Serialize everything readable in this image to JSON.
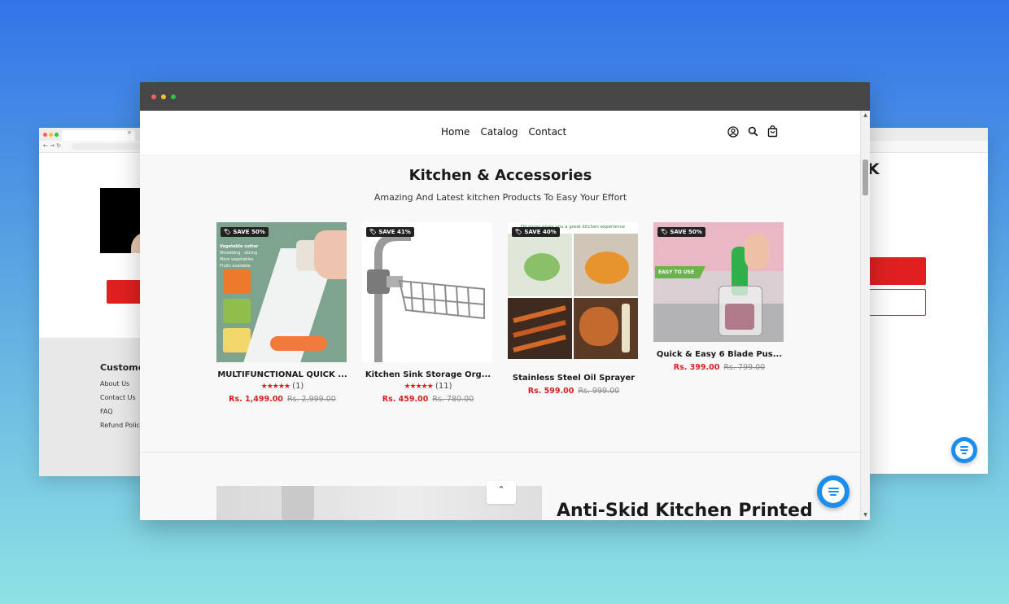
{
  "colors": {
    "accent": "#d62020",
    "chat": "#1a8ef0",
    "titlebar": "#464646"
  },
  "nav": {
    "items": [
      "Home",
      "Catalog",
      "Contact"
    ]
  },
  "header_icons": [
    "account-icon",
    "search-icon",
    "cart-icon"
  ],
  "section": {
    "title": "Kitchen & Accessories",
    "subtitle": "Amazing And Latest kitchen Products To Easy Your Effort"
  },
  "products": [
    {
      "badge": "SAVE 50%",
      "name": "MULTIFUNCTIONAL QUICK ...",
      "stars": "★★★★★",
      "reviews": "(1)",
      "price": "Rs. 1,499.00",
      "compare": "Rs. 2,999.00",
      "img_text": [
        "Vegetable cutter",
        "Shredding · slicing",
        "More vegetables",
        "Fruits available"
      ]
    },
    {
      "badge": "SAVE 41%",
      "name": "Kitchen Sink Storage Org...",
      "stars": "★★★★★",
      "reviews": "(11)",
      "price": "Rs. 459.00",
      "compare": "Rs. 780.00"
    },
    {
      "badge": "SAVE 40%",
      "name": "Stainless Steel Oil Sprayer",
      "price": "Rs. 599.00",
      "compare": "Rs. 999.00",
      "img_text": [
        "Oil spray gives you a great kitchen experience"
      ]
    },
    {
      "badge": "SAVE 50%",
      "name": "Quick & Easy 6 Blade Pus...",
      "price": "Rs. 399.00",
      "compare": "Rs. 799.00",
      "img_text": [
        "EASY TO USE"
      ]
    }
  ],
  "back_to_top": "⌃",
  "banner": {
    "title": "Anti-Skid Kitchen Printed"
  },
  "background_pages": {
    "left": {
      "footer_title": "Customer",
      "links": [
        "About Us",
        "Contact Us",
        "FAQ",
        "Refund Polic"
      ]
    },
    "right": {
      "heading_fragment": "K"
    }
  }
}
